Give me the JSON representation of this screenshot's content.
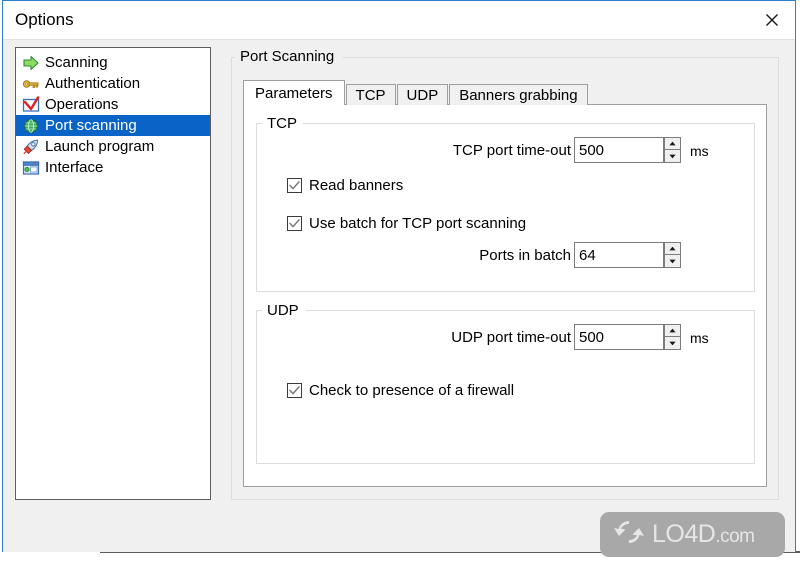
{
  "window": {
    "title": "Options",
    "close_icon": "close-icon",
    "accent_border": "#2f7fd0"
  },
  "sidebar": {
    "items": [
      {
        "label": "Scanning",
        "icon": "green-arrow-icon",
        "selected": false
      },
      {
        "label": "Authentication",
        "icon": "gold-key-icon",
        "selected": false
      },
      {
        "label": "Operations",
        "icon": "red-check-icon",
        "selected": false
      },
      {
        "label": "Port scanning",
        "icon": "globe-icon",
        "selected": true
      },
      {
        "label": "Launch program",
        "icon": "rocket-icon",
        "selected": false
      },
      {
        "label": "Interface",
        "icon": "window-icon",
        "selected": false
      }
    ],
    "selection_color": "#0a64c8"
  },
  "main": {
    "group_title": "Port Scanning",
    "tabs": [
      {
        "label": "Parameters",
        "active": true
      },
      {
        "label": "TCP",
        "active": false
      },
      {
        "label": "UDP",
        "active": false
      },
      {
        "label": "Banners grabbing",
        "active": false
      }
    ],
    "tcp_section": {
      "title": "TCP",
      "timeout_label": "TCP port time-out",
      "timeout_value": "500",
      "timeout_unit": "ms",
      "read_banners_label": "Read banners",
      "read_banners_checked": true,
      "use_batch_label": "Use batch for TCP port scanning",
      "use_batch_checked": true,
      "ports_in_batch_label": "Ports in batch",
      "ports_in_batch_value": "64"
    },
    "udp_section": {
      "title": "UDP",
      "timeout_label": "UDP port time-out",
      "timeout_value": "500",
      "timeout_unit": "ms",
      "firewall_label": "Check to presence of a firewall",
      "firewall_checked": true
    }
  },
  "watermark": {
    "text": "LO4D",
    "suffix": ".com",
    "icon": "refresh-arrows-icon"
  }
}
